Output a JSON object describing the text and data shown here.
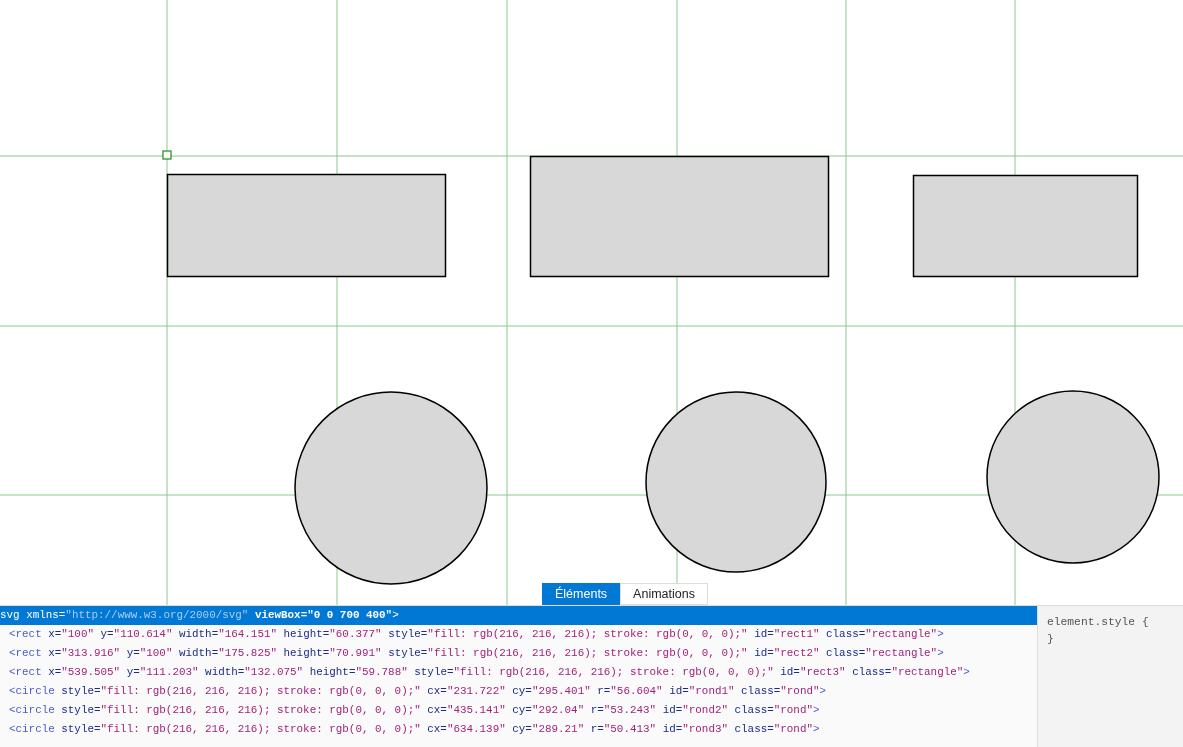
{
  "tabs": [
    {
      "label": "Éléments",
      "selected": true
    },
    {
      "label": "Animations",
      "selected": false
    }
  ],
  "dom_tree": {
    "lines": [
      {
        "selected": true,
        "tokens": [
          {
            "kind": "tag",
            "text": "svg"
          },
          {
            "kind": "attr",
            "text": " xmlns="
          },
          {
            "kind": "value",
            "text": "\"http://www.w3.org/2000/svg\""
          },
          {
            "kind": "highlight",
            "text": " viewBox=\"0 0 700 400\""
          },
          {
            "kind": "tag",
            "text": ">"
          }
        ]
      },
      {
        "selected": false,
        "tokens": [
          {
            "kind": "tag",
            "text": "<rect"
          },
          {
            "kind": "attr",
            "text": " x="
          },
          {
            "kind": "value",
            "text": "\"100\""
          },
          {
            "kind": "attr",
            "text": " y="
          },
          {
            "kind": "value",
            "text": "\"110.614\""
          },
          {
            "kind": "attr",
            "text": " width="
          },
          {
            "kind": "value",
            "text": "\"164.151\""
          },
          {
            "kind": "attr",
            "text": " height="
          },
          {
            "kind": "value",
            "text": "\"60.377\""
          },
          {
            "kind": "attr",
            "text": " style="
          },
          {
            "kind": "value",
            "text": "\"fill: rgb(216, 216, 216); stroke: rgb(0, 0, 0);\""
          },
          {
            "kind": "attr",
            "text": " id="
          },
          {
            "kind": "value",
            "text": "\"rect1\""
          },
          {
            "kind": "attr",
            "text": " class="
          },
          {
            "kind": "value",
            "text": "\"rectangle\""
          },
          {
            "kind": "tag",
            "text": ">"
          }
        ]
      },
      {
        "selected": false,
        "tokens": [
          {
            "kind": "tag",
            "text": "<rect"
          },
          {
            "kind": "attr",
            "text": " x="
          },
          {
            "kind": "value",
            "text": "\"313.916\""
          },
          {
            "kind": "attr",
            "text": " y="
          },
          {
            "kind": "value",
            "text": "\"100\""
          },
          {
            "kind": "attr",
            "text": " width="
          },
          {
            "kind": "value",
            "text": "\"175.825\""
          },
          {
            "kind": "attr",
            "text": " height="
          },
          {
            "kind": "value",
            "text": "\"70.991\""
          },
          {
            "kind": "attr",
            "text": " style="
          },
          {
            "kind": "value",
            "text": "\"fill: rgb(216, 216, 216); stroke: rgb(0, 0, 0);\""
          },
          {
            "kind": "attr",
            "text": " id="
          },
          {
            "kind": "value",
            "text": "\"rect2\""
          },
          {
            "kind": "attr",
            "text": " class="
          },
          {
            "kind": "value",
            "text": "\"rectangle\""
          },
          {
            "kind": "tag",
            "text": ">"
          }
        ]
      },
      {
        "selected": false,
        "tokens": [
          {
            "kind": "tag",
            "text": "<rect"
          },
          {
            "kind": "attr",
            "text": " x="
          },
          {
            "kind": "value",
            "text": "\"539.505\""
          },
          {
            "kind": "attr",
            "text": " y="
          },
          {
            "kind": "value",
            "text": "\"111.203\""
          },
          {
            "kind": "attr",
            "text": " width="
          },
          {
            "kind": "value",
            "text": "\"132.075\""
          },
          {
            "kind": "attr",
            "text": " height="
          },
          {
            "kind": "value",
            "text": "\"59.788\""
          },
          {
            "kind": "attr",
            "text": " style="
          },
          {
            "kind": "value",
            "text": "\"fill: rgb(216, 216, 216); stroke: rgb(0, 0, 0);\""
          },
          {
            "kind": "attr",
            "text": " id="
          },
          {
            "kind": "value",
            "text": "\"rect3\""
          },
          {
            "kind": "attr",
            "text": " class="
          },
          {
            "kind": "value",
            "text": "\"rectangle\""
          },
          {
            "kind": "tag",
            "text": ">"
          }
        ]
      },
      {
        "selected": false,
        "tokens": [
          {
            "kind": "tag",
            "text": "<circle"
          },
          {
            "kind": "attr",
            "text": " style="
          },
          {
            "kind": "value",
            "text": "\"fill: rgb(216, 216, 216); stroke: rgb(0, 0, 0);\""
          },
          {
            "kind": "attr",
            "text": " cx="
          },
          {
            "kind": "value",
            "text": "\"231.722\""
          },
          {
            "kind": "attr",
            "text": " cy="
          },
          {
            "kind": "value",
            "text": "\"295.401\""
          },
          {
            "kind": "attr",
            "text": " r="
          },
          {
            "kind": "value",
            "text": "\"56.604\""
          },
          {
            "kind": "attr",
            "text": " id="
          },
          {
            "kind": "value",
            "text": "\"rond1\""
          },
          {
            "kind": "attr",
            "text": " class="
          },
          {
            "kind": "value",
            "text": "\"rond\""
          },
          {
            "kind": "tag",
            "text": ">"
          }
        ]
      },
      {
        "selected": false,
        "tokens": [
          {
            "kind": "tag",
            "text": "<circle"
          },
          {
            "kind": "attr",
            "text": " style="
          },
          {
            "kind": "value",
            "text": "\"fill: rgb(216, 216, 216); stroke: rgb(0, 0, 0);\""
          },
          {
            "kind": "attr",
            "text": " cx="
          },
          {
            "kind": "value",
            "text": "\"435.141\""
          },
          {
            "kind": "attr",
            "text": " cy="
          },
          {
            "kind": "value",
            "text": "\"292.04\""
          },
          {
            "kind": "attr",
            "text": " r="
          },
          {
            "kind": "value",
            "text": "\"53.243\""
          },
          {
            "kind": "attr",
            "text": " id="
          },
          {
            "kind": "value",
            "text": "\"rond2\""
          },
          {
            "kind": "attr",
            "text": " class="
          },
          {
            "kind": "value",
            "text": "\"rond\""
          },
          {
            "kind": "tag",
            "text": ">"
          }
        ]
      },
      {
        "selected": false,
        "tokens": [
          {
            "kind": "tag",
            "text": "<circle"
          },
          {
            "kind": "attr",
            "text": " style="
          },
          {
            "kind": "value",
            "text": "\"fill: rgb(216, 216, 216); stroke: rgb(0, 0, 0);\""
          },
          {
            "kind": "attr",
            "text": " cx="
          },
          {
            "kind": "value",
            "text": "\"634.139\""
          },
          {
            "kind": "attr",
            "text": " cy="
          },
          {
            "kind": "value",
            "text": "\"289.21\""
          },
          {
            "kind": "attr",
            "text": " r="
          },
          {
            "kind": "value",
            "text": "\"50.413\""
          },
          {
            "kind": "attr",
            "text": " id="
          },
          {
            "kind": "value",
            "text": "\"rond3\""
          },
          {
            "kind": "attr",
            "text": " class="
          },
          {
            "kind": "value",
            "text": "\"rond\""
          },
          {
            "kind": "tag",
            "text": ">"
          }
        ]
      }
    ]
  },
  "styles_pane": {
    "lines": [
      "element.style {",
      "}"
    ]
  }
}
